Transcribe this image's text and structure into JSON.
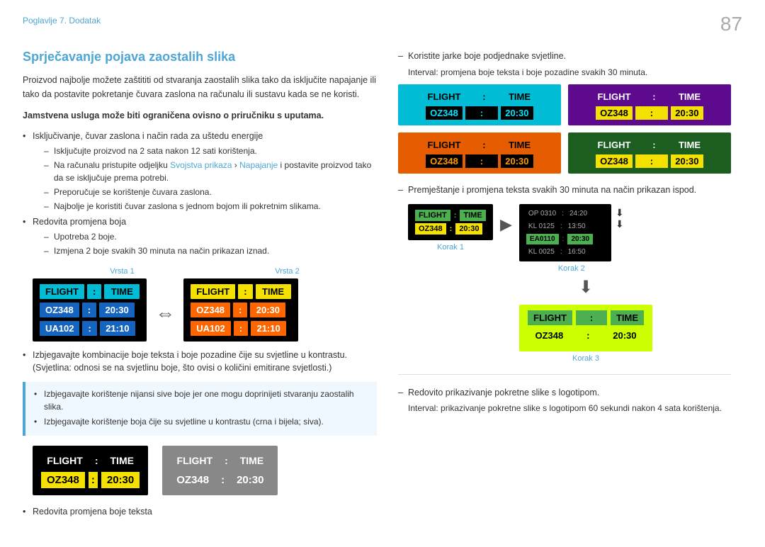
{
  "page": {
    "number": "87",
    "chapter": "Poglavlje 7. Dodatak"
  },
  "section": {
    "title": "Sprječavanje pojava zaostalih slika",
    "intro1": "Proizvod najbolje možete zaštititi od stvaranja zaostalih slika tako da isključite napajanje ili tako da postavite pokretanje čuvara zaslona na računalu ili sustavu kada se ne koristi.",
    "intro2_bold": "Jamstvena usluga može biti ograničena ovisno o priručniku s uputama.",
    "list1_title": "Isključivanje, čuvar zaslona i način rada za uštedu energije",
    "list1_items": [
      "Isključujte proizvod na 2 sata nakon 12 sati korištenja.",
      "Na računalu pristupite odjeljku Svojstva prikaza > Napajanje i postavite proizvod tako da se isključuje prema potrebi.",
      "Preporučuje se korištenje čuvara zaslona.",
      "Najbolje je koristiti čuvar zaslona s jednom bojom ili pokretnim slikama."
    ],
    "list2_title": "Redovita promjena boja",
    "list2_sub1": "Upotreba 2 boje.",
    "list2_sub2": "Izmjena 2 boje svakih 30 minuta na način prikazan iznad.",
    "vrsta1_label": "Vrsta 1",
    "vrsta2_label": "Vrsta 2",
    "highlight_items": [
      "Izbjegavajte korištenje nijansi sive boje jer one mogu doprinijeti stvaranju zaostalih slika.",
      "Izbjegavajte korištenje boja čije su svjetline u kontrastu (crna i bijela; siva)."
    ],
    "avoid_text": "Izbjegavajte kombinacije boje teksta i boje pozadine čije su svjetline u kontrastu. (Svjetlina: odnosi se na svjetlinu boje, što ovisi o količini emitirane svjetlosti.)",
    "redovita_label": "Redovita promjena boje teksta",
    "right_dash1": "Koristite jarke boje podjednake svjetline.",
    "right_dash1_sub": "Interval: promjena boje teksta i boje pozadine svakih 30 minuta.",
    "right_dash2": "Premještanje i promjena teksta svakih 30 minuta na način prikazan ispod.",
    "korak1_label": "Korak 1",
    "korak2_label": "Korak 2",
    "korak3_label": "Korak 3",
    "right_dash3": "Redovito prikazivanje pokretne slike s logotipom.",
    "right_dash3_sub": "Interval: prikazivanje pokretne slike s logotipom 60 sekundi nakon 4 sata korištenja.",
    "boards": {
      "flight": "FLIGHT",
      "time": "TIME",
      "colon": ":",
      "oz348": "OZ348",
      "ua102": "UA102",
      "t2030": "20:30",
      "t2110": "21:10",
      "kl0125": "KL 0125",
      "t1350": "13:50",
      "ea0110": "EA0110",
      "t2030b": "20:30",
      "kl0025": "KL 0025",
      "t1650": "16:50",
      "op0310": "OP 0310",
      "t2420": "24:20"
    }
  }
}
